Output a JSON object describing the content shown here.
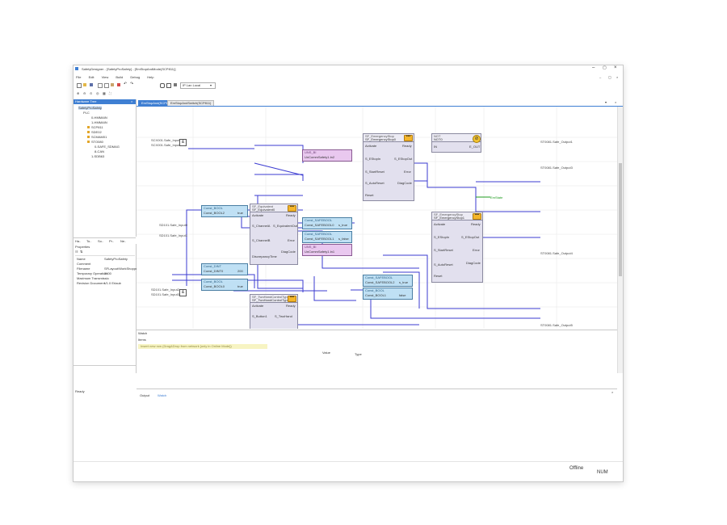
{
  "app": {
    "title": "SafetyDesigner - [SafetyProSafety] - [EmStopAndMode(SCP811)]",
    "status": "Ready"
  },
  "menu": [
    "File",
    "Edit",
    "View",
    "Build",
    "Debug",
    "Help"
  ],
  "toolbar": {
    "connection": "IP Lan Local"
  },
  "hardware_tree": {
    "title": "Hardware Tree",
    "root": "SafetyProSafety",
    "items": [
      "PLC",
      "0-HMMAIN",
      "1-HMMAIN",
      "SCP811",
      "SDE02",
      "SCMAM01",
      "STO080",
      "0-SAFE_SDMAG",
      "8-CAN",
      "1-SDB63"
    ]
  },
  "panel_tabs": [
    "Ha..",
    "To..",
    "So..",
    "Pr..",
    "Ne.."
  ],
  "properties": {
    "title": "Properties",
    "rows": [
      {
        "label": "Name",
        "value": "SafetyProSafety"
      },
      {
        "label": "Comment",
        "value": ""
      },
      {
        "label": "Filename",
        "value": "SFLayout/WorkShopper.Sa"
      },
      {
        "label": "Temporary Operation",
        "value": "3600"
      },
      {
        "label": "Maximum Transmissio",
        "value": ""
      },
      {
        "label": "Revision Document",
        "value": "V1.0 Erlaub"
      }
    ]
  },
  "doc_tabs": [
    "EmStopAnd(SCP811)",
    "EmStopAndSwitch(SCP811)"
  ],
  "diagram": {
    "inputs": [
      "SCX001.Safe_Input0",
      "SCX001.Safe_Input1",
      "SD101.Safe_Input0",
      "SD101.Safe_Input1",
      "SD101.Safe_Input2",
      "SD101.Safe_Input3"
    ],
    "outputs": [
      "ST0081.Safe_Output1",
      "ST0081.Safe_Output3",
      "EmState",
      "ST0081.Safe_Output4",
      "ST0081.Safe_Output5"
    ],
    "fb_emergency0": {
      "type": "SF_EmergencyStop",
      "name": "SF_EmergencyStop0",
      "pins_left": [
        "Activate",
        "S_EStopIn",
        "S_StartReset",
        "S_AutoReset",
        "Reset"
      ],
      "pins_right": [
        "Ready",
        "S_EStopOut",
        "Error",
        "DiagCode"
      ]
    },
    "fb_not": {
      "type": "NOT",
      "name": "NOT0",
      "in": "IN",
      "out": "E_OUT"
    },
    "fb_equiv": {
      "type": "SF_Equivalent",
      "name": "SF_Equivalent0",
      "pins_left": [
        "Activate",
        "S_ChannelA",
        "S_ChannelB",
        "DiscrepancyTime"
      ],
      "pins_right": [
        "Ready",
        "S_EquivalentOut",
        "Error",
        "DiagCode"
      ]
    },
    "fb_emergency1": {
      "type": "SF_EmergencyStop",
      "name": "SF_EmergencyStop1",
      "pins_left": [
        "Activate",
        "S_EStopIn",
        "S_StartReset",
        "S_AutoReset",
        "Reset"
      ],
      "pins_right": [
        "Ready",
        "S_EStopOut",
        "Error",
        "DiagCode"
      ]
    },
    "fb_twohand": {
      "type": "SF_TwoHandControlTypeII",
      "name": "SF_TwoHandControlTypeII0",
      "pins_left": [
        "Activate",
        "S_Button1"
      ],
      "pins_right": [
        "Ready",
        "S_TwoHand"
      ]
    },
    "vars_pink": [
      {
        "type": "UNS_BI",
        "name": "UnCommSafety1.In2"
      },
      {
        "type": "UNS_BI",
        "name": "UnCommSafety1.In1"
      }
    ],
    "vars_blue": [
      {
        "type": "Const_SAFEBOOL",
        "name": "Const_SAFEBOOL0",
        "pin": "s_true"
      },
      {
        "type": "Const_SAFEBOOL",
        "name": "Const_SAFEBOOL1",
        "pin": "s_false"
      },
      {
        "type": "Const_BOOL",
        "name": "Const_BOOL0",
        "pin": "true"
      },
      {
        "type": "Const_DINT",
        "name": "Const_DINT0",
        "pin": "200"
      },
      {
        "type": "Const_SAFEBOOL",
        "name": "Const_SAFEBOOL2",
        "pin": "s_true"
      },
      {
        "type": "Const_BOOL",
        "name": "Const_BOOL1",
        "pin": "false"
      },
      {
        "type": "Const_BOOL",
        "name": "Const_BOOL2",
        "pin": "true"
      }
    ]
  },
  "watch": {
    "title": "Watch",
    "items_label": "Items",
    "hint": "Insert new row (Drag&Drop from network [only in Online Mode])",
    "columns": [
      "Value",
      "Type"
    ]
  },
  "bottom_tabs": [
    "Output",
    "Watch"
  ],
  "statusbar": {
    "mode": "Offline",
    "num": "NUM"
  },
  "colors": {
    "accent": "#3f7fd3",
    "fb": "#e2e0ee",
    "var_pink": "#e9c8ef",
    "var_blue": "#bfe0f4",
    "wire": "#3b3bd1",
    "ok_green": "#1f9b1f",
    "dots": "#f4b52a"
  }
}
